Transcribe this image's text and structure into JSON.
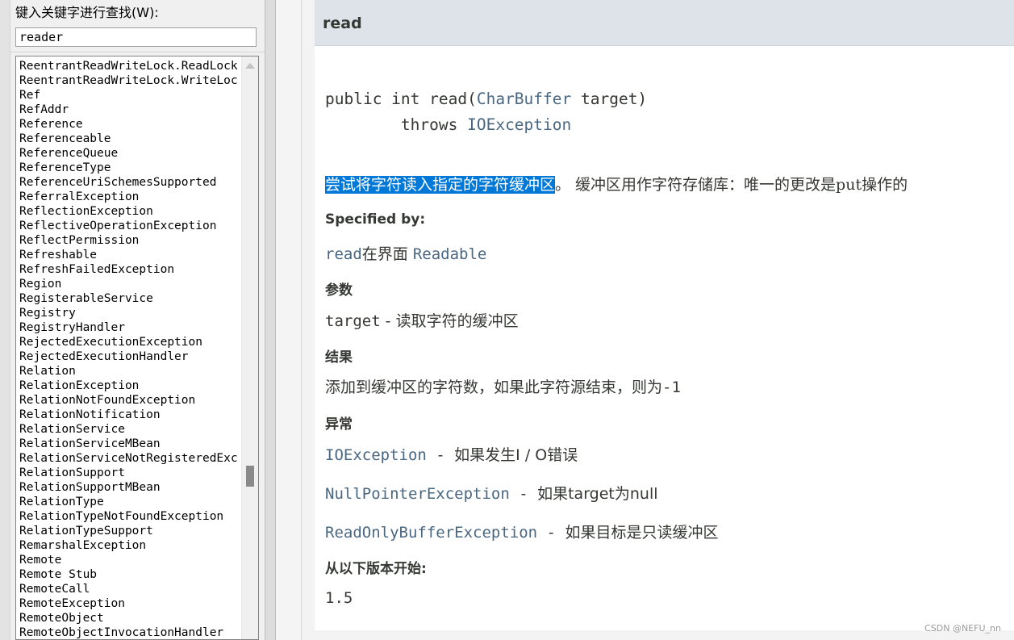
{
  "search": {
    "label": "键入关键字进行查找(W):",
    "value": "reader"
  },
  "index_items": [
    "ReentrantReadWriteLock.ReadLock",
    "ReentrantReadWriteLock.WriteLock",
    "Ref",
    "RefAddr",
    "Reference",
    "Referenceable",
    "ReferenceQueue",
    "ReferenceType",
    "ReferenceUriSchemesSupported",
    "ReferralException",
    "ReflectionException",
    "ReflectiveOperationException",
    "ReflectPermission",
    "Refreshable",
    "RefreshFailedException",
    "Region",
    "RegisterableService",
    "Registry",
    "RegistryHandler",
    "RejectedExecutionException",
    "RejectedExecutionHandler",
    "Relation",
    "RelationException",
    "RelationNotFoundException",
    "RelationNotification",
    "RelationService",
    "RelationServiceMBean",
    "RelationServiceNotRegisteredException",
    "RelationSupport",
    "RelationSupportMBean",
    "RelationType",
    "RelationTypeNotFoundException",
    "RelationTypeSupport",
    "RemarshalException",
    "Remote",
    "Remote Stub",
    "RemoteCall",
    "RemoteException",
    "RemoteObject",
    "RemoteObjectInvocationHandler"
  ],
  "scrollbar": {
    "position_fraction": 0.72
  },
  "doc": {
    "method_name": "read",
    "signature": {
      "prefix": "public int read(",
      "param_type": "CharBuffer",
      "param_name": " target)",
      "throws_kw": "throws ",
      "exception": "IOException"
    },
    "description": {
      "highlighted": "尝试将字符读入指定的字符缓冲区",
      "rest": "。 缓冲区用作字符存储库：唯一的更改是put操作的"
    },
    "specified_by": {
      "heading": "Specified by:",
      "method_link": "read",
      "middle": "在界面 ",
      "interface_link": "Readable"
    },
    "params": {
      "heading": "参数",
      "name": "target",
      "desc": " - 读取字符的缓冲区"
    },
    "returns": {
      "heading": "结果",
      "text": "添加到缓冲区的字符数，如果此字符源结束，则为",
      "value": "-1"
    },
    "exceptions": {
      "heading": "异常",
      "items": [
        {
          "name": "IOException",
          "sep": " - ",
          "desc": "如果发生I / O错误"
        },
        {
          "name": "NullPointerException",
          "sep": " - ",
          "desc": "如果target为null"
        },
        {
          "name": "ReadOnlyBufferException",
          "sep": " - ",
          "desc": "如果目标是只读缓冲区"
        }
      ]
    },
    "since": {
      "heading": "从以下版本开始:",
      "value": "1.5"
    }
  },
  "watermark": "CSDN @NEFU_nn"
}
